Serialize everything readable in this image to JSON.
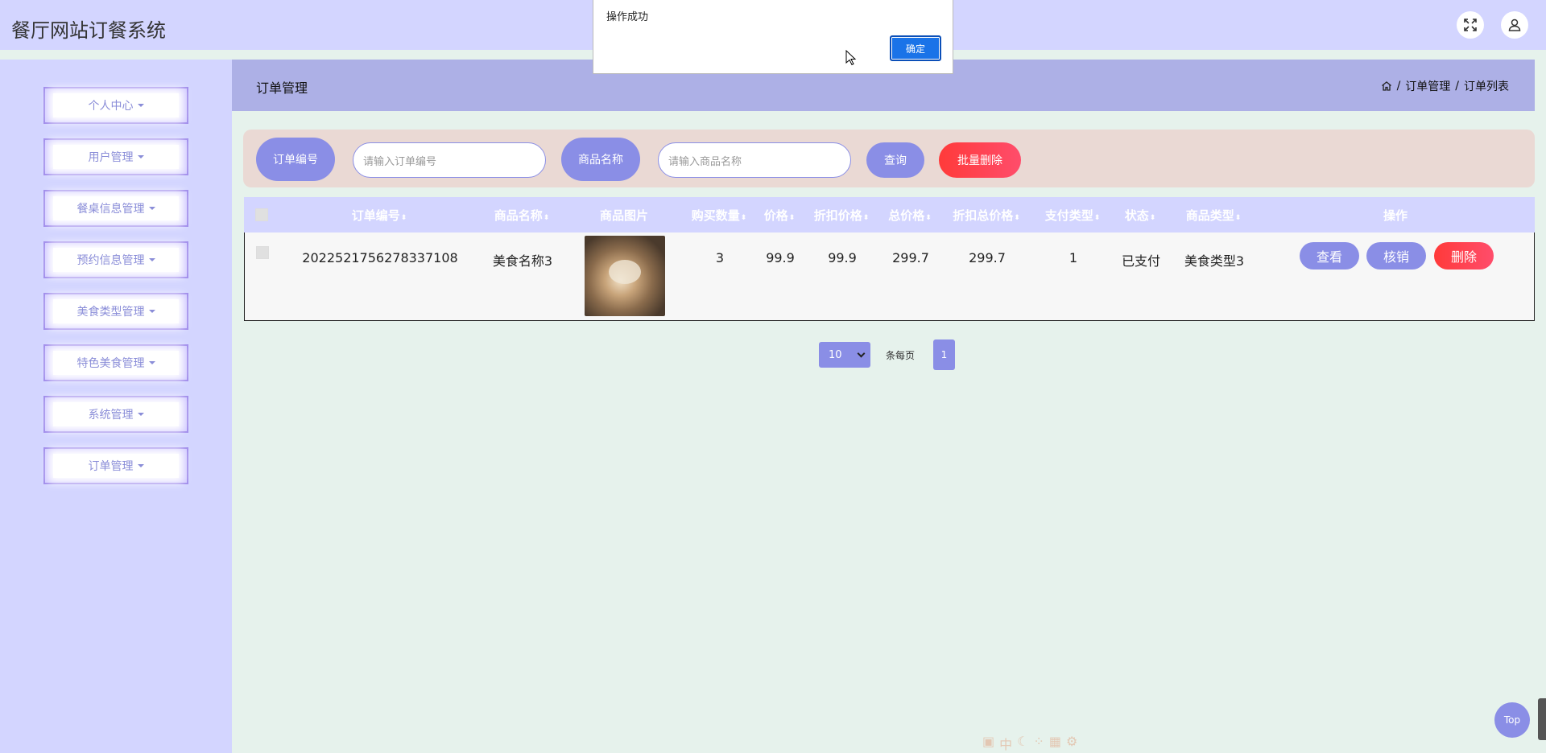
{
  "app": {
    "title": "餐厅网站订餐系统"
  },
  "header": {
    "fullscreen_icon": "expand-icon",
    "user_icon": "user-icon"
  },
  "sidebar": {
    "items": [
      {
        "label": "个人中心"
      },
      {
        "label": "用户管理"
      },
      {
        "label": "餐桌信息管理"
      },
      {
        "label": "预约信息管理"
      },
      {
        "label": "美食类型管理"
      },
      {
        "label": "特色美食管理"
      },
      {
        "label": "系统管理"
      },
      {
        "label": "订单管理"
      }
    ]
  },
  "page": {
    "title": "订单管理",
    "breadcrumb": [
      "订单管理",
      "订单列表"
    ]
  },
  "search": {
    "order_no_label": "订单编号",
    "order_no_placeholder": "请输入订单编号",
    "goods_name_label": "商品名称",
    "goods_name_placeholder": "请输入商品名称",
    "query_label": "查询",
    "batch_delete_label": "批量删除"
  },
  "table": {
    "columns": [
      "订单编号",
      "商品名称",
      "商品图片",
      "购买数量",
      "价格",
      "折扣价格",
      "总价格",
      "折扣总价格",
      "支付类型",
      "状态",
      "商品类型",
      "操作"
    ],
    "rows": [
      {
        "order_no": "2022521756278337108",
        "goods_name": "美食名称3",
        "quantity": "3",
        "price": "99.9",
        "discount_price": "99.9",
        "total": "299.7",
        "discount_total": "299.7",
        "pay_type": "1",
        "status": "已支付",
        "goods_type": "美食类型3",
        "actions": [
          "查看",
          "核销",
          "删除"
        ]
      }
    ]
  },
  "pagination": {
    "page_size": "10",
    "per_page_label": "条每页",
    "current_page": "1"
  },
  "dialog": {
    "message": "操作成功",
    "ok_label": "确定"
  },
  "top_button": {
    "label": "Top"
  },
  "ime_toolbar": {
    "label": "中"
  }
}
